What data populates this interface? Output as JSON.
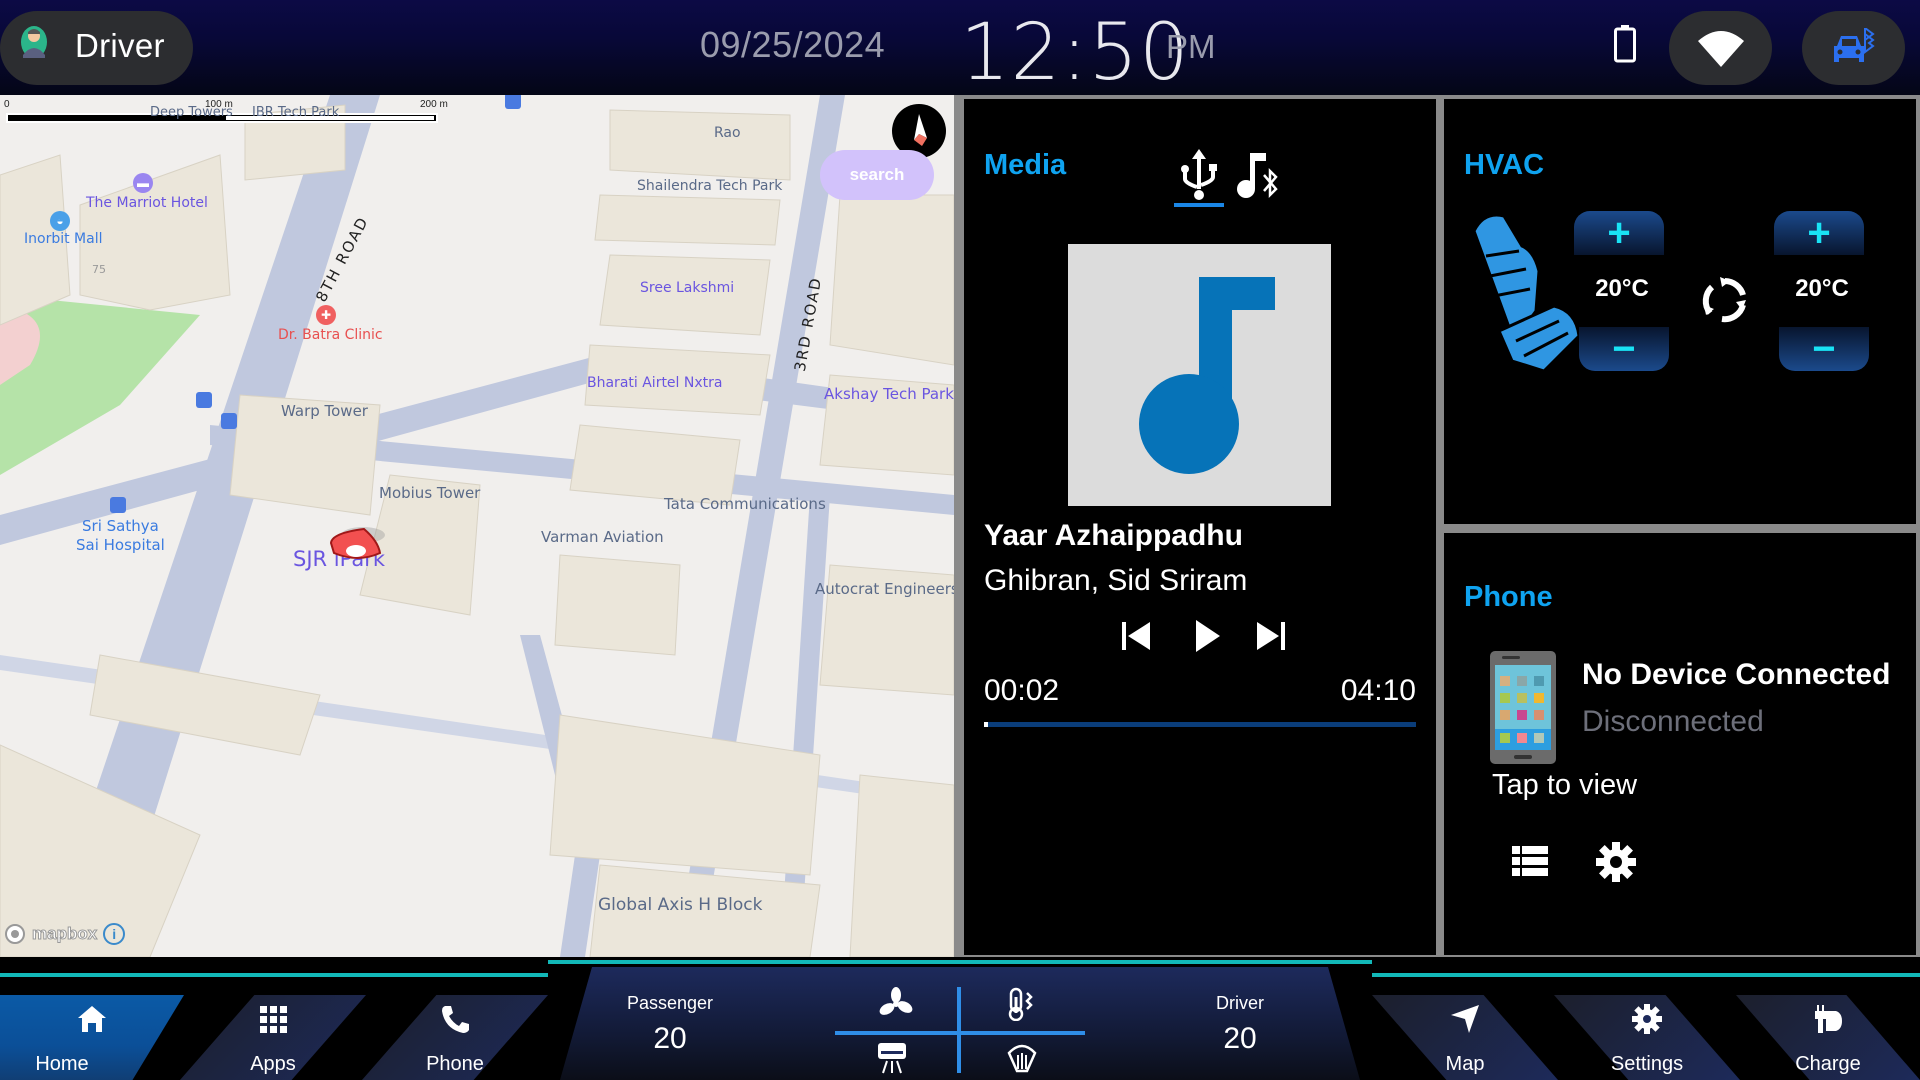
{
  "topbar": {
    "profile_name": "Driver",
    "date": "09/25/2024",
    "time": "12:50",
    "ampm": "PM",
    "icons": [
      "avatar-icon",
      "battery-icon",
      "wifi-icon",
      "car-bluetooth-icon"
    ]
  },
  "map": {
    "scale": {
      "start": "0",
      "mid": "100 m",
      "end": "200 m"
    },
    "search_label": "search",
    "attribution": "mapbox",
    "roads": [
      "8TH ROAD",
      "3RD ROAD"
    ],
    "places": [
      {
        "name": "Deep Towers",
        "style": "gray"
      },
      {
        "name": "IBR Tech Park",
        "style": "gray"
      },
      {
        "name": "Rao",
        "style": "gray"
      },
      {
        "name": "Shailendra Tech Park",
        "style": "gray"
      },
      {
        "name": "The Marriot Hotel",
        "style": "purple"
      },
      {
        "name": "Inorbit Mall",
        "style": "blue"
      },
      {
        "name": "Sree Lakshmi",
        "style": "purple"
      },
      {
        "name": "Dr. Batra Clinic",
        "style": "red"
      },
      {
        "name": "Bharati Airtel Nxtra",
        "style": "purple"
      },
      {
        "name": "Akshay Tech Park",
        "style": "purple"
      },
      {
        "name": "Warp Tower",
        "style": "gray"
      },
      {
        "name": "Mobius Tower",
        "style": "gray"
      },
      {
        "name": "Tata Communications",
        "style": "gray"
      },
      {
        "name": "Sri Sathya\nSai Hospital",
        "style": "blue"
      },
      {
        "name": "Varman Aviation",
        "style": "gray"
      },
      {
        "name": "SJR iPark",
        "style": "purple"
      },
      {
        "name": "Autocrat Engineers",
        "style": "gray"
      },
      {
        "name": "Global Axis H Block",
        "style": "gray"
      }
    ],
    "building_number": "75"
  },
  "media": {
    "title": "Media",
    "sources": [
      {
        "name": "usb",
        "active": true
      },
      {
        "name": "bluetooth-audio",
        "active": false
      }
    ],
    "song_title": "Yaar Azhaippadhu",
    "artist": "Ghibran, Sid Sriram",
    "elapsed": "00:02",
    "total": "04:10",
    "progress_fraction": 0.008
  },
  "hvac": {
    "title": "HVAC",
    "left_temp": "20°C",
    "right_temp": "20°C",
    "plus": "+",
    "minus": "−"
  },
  "phone": {
    "title": "Phone",
    "status": "No Device Connected",
    "substatus": "Disconnected",
    "tap_label": "Tap to view"
  },
  "bottom_nav": {
    "left": [
      {
        "label": "Home",
        "icon": "home-icon",
        "active": true
      },
      {
        "label": "Apps",
        "icon": "apps-grid-icon",
        "active": false
      },
      {
        "label": "Phone",
        "icon": "phone-icon",
        "active": false
      }
    ],
    "right": [
      {
        "label": "Map",
        "icon": "navigation-icon",
        "active": false
      },
      {
        "label": "Settings",
        "icon": "gear-icon",
        "active": false
      },
      {
        "label": "Charge",
        "icon": "charge-plug-icon",
        "active": false
      }
    ],
    "climate": {
      "passenger_label": "Passenger",
      "passenger_temp": "20",
      "driver_label": "Driver",
      "driver_temp": "20",
      "controls": [
        "fan-icon",
        "temperature-icon",
        "ac-vent-icon",
        "rear-defrost-icon"
      ]
    }
  },
  "colors": {
    "accent_blue": "#0fa3f0",
    "teal_line": "#12b8b8",
    "hvac_button_cyan": "#19e3f5",
    "seat_blue": "#2f96e2",
    "pin_red": "#f25050",
    "search_purple": "#d2c2fb"
  }
}
